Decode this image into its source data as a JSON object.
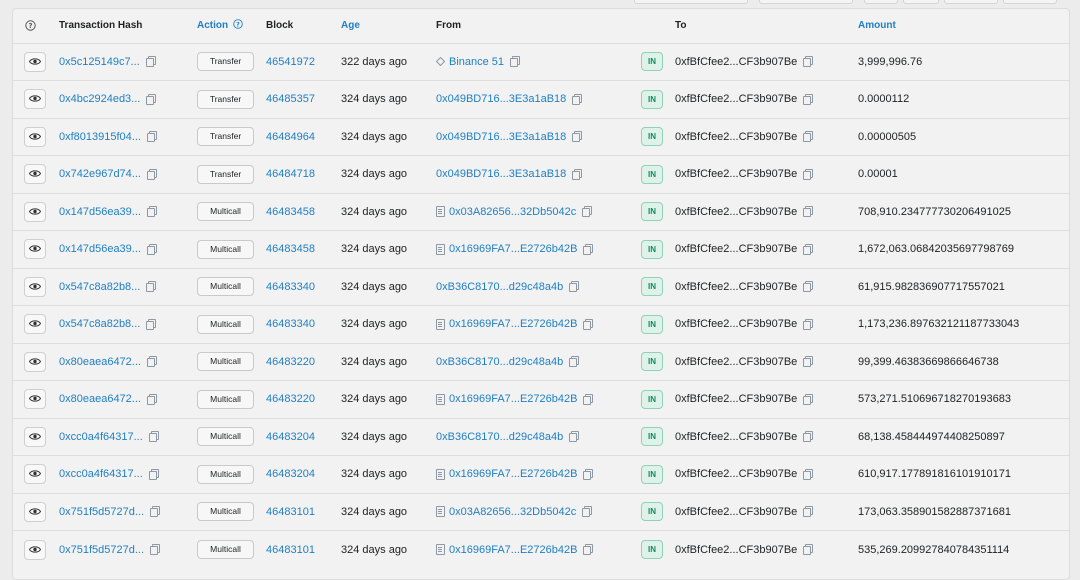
{
  "header": {
    "info_icon": "question-circle-icon",
    "transaction_hash": "Transaction Hash",
    "action": "Action",
    "action_icon": "question-circle-icon",
    "block": "Block",
    "age": "Age",
    "from": "From",
    "to": "To",
    "amount": "Amount"
  },
  "rows": [
    {
      "hash": "0x5c125149c7...",
      "action": "Transfer",
      "block": "46541972",
      "age": "322 days ago",
      "from": "Binance 51",
      "from_icon": "diamond-icon",
      "direction": "IN",
      "to": "0xfBfCfee2...CF3b907Be",
      "amount": "3,999,996.76"
    },
    {
      "hash": "0x4bc2924ed3...",
      "action": "Transfer",
      "block": "46485357",
      "age": "324 days ago",
      "from": "0x049BD716...3E3a1aB18",
      "from_icon": "",
      "direction": "IN",
      "to": "0xfBfCfee2...CF3b907Be",
      "amount": "0.0000112"
    },
    {
      "hash": "0xf8013915f04...",
      "action": "Transfer",
      "block": "46484964",
      "age": "324 days ago",
      "from": "0x049BD716...3E3a1aB18",
      "from_icon": "",
      "direction": "IN",
      "to": "0xfBfCfee2...CF3b907Be",
      "amount": "0.00000505"
    },
    {
      "hash": "0x742e967d74...",
      "action": "Transfer",
      "block": "46484718",
      "age": "324 days ago",
      "from": "0x049BD716...3E3a1aB18",
      "from_icon": "",
      "direction": "IN",
      "to": "0xfBfCfee2...CF3b907Be",
      "amount": "0.00001"
    },
    {
      "hash": "0x147d56ea39...",
      "action": "Multicall",
      "block": "46483458",
      "age": "324 days ago",
      "from": "0x03A82656...32Db5042c",
      "from_icon": "contract-icon",
      "direction": "IN",
      "to": "0xfBfCfee2...CF3b907Be",
      "amount": "708,910.234777730206491025"
    },
    {
      "hash": "0x147d56ea39...",
      "action": "Multicall",
      "block": "46483458",
      "age": "324 days ago",
      "from": "0x16969FA7...E2726b42B",
      "from_icon": "contract-icon",
      "direction": "IN",
      "to": "0xfBfCfee2...CF3b907Be",
      "amount": "1,672,063.06842035697798769"
    },
    {
      "hash": "0x547c8a82b8...",
      "action": "Multicall",
      "block": "46483340",
      "age": "324 days ago",
      "from": "0xB36C8170...d29c48a4b",
      "from_icon": "",
      "direction": "IN",
      "to": "0xfBfCfee2...CF3b907Be",
      "amount": "61,915.982836907717557021"
    },
    {
      "hash": "0x547c8a82b8...",
      "action": "Multicall",
      "block": "46483340",
      "age": "324 days ago",
      "from": "0x16969FA7...E2726b42B",
      "from_icon": "contract-icon",
      "direction": "IN",
      "to": "0xfBfCfee2...CF3b907Be",
      "amount": "1,173,236.897632121187733043"
    },
    {
      "hash": "0x80eaea6472...",
      "action": "Multicall",
      "block": "46483220",
      "age": "324 days ago",
      "from": "0xB36C8170...d29c48a4b",
      "from_icon": "",
      "direction": "IN",
      "to": "0xfBfCfee2...CF3b907Be",
      "amount": "99,399.46383669866646738"
    },
    {
      "hash": "0x80eaea6472...",
      "action": "Multicall",
      "block": "46483220",
      "age": "324 days ago",
      "from": "0x16969FA7...E2726b42B",
      "from_icon": "contract-icon",
      "direction": "IN",
      "to": "0xfBfCfee2...CF3b907Be",
      "amount": "573,271.510696718270193683"
    },
    {
      "hash": "0xcc0a4f64317...",
      "action": "Multicall",
      "block": "46483204",
      "age": "324 days ago",
      "from": "0xB36C8170...d29c48a4b",
      "from_icon": "",
      "direction": "IN",
      "to": "0xfBfCfee2...CF3b907Be",
      "amount": "68,138.458444974408250897"
    },
    {
      "hash": "0xcc0a4f64317...",
      "action": "Multicall",
      "block": "46483204",
      "age": "324 days ago",
      "from": "0x16969FA7...E2726b42B",
      "from_icon": "contract-icon",
      "direction": "IN",
      "to": "0xfBfCfee2...CF3b907Be",
      "amount": "610,917.177891816101910171"
    },
    {
      "hash": "0x751f5d5727d...",
      "action": "Multicall",
      "block": "46483101",
      "age": "324 days ago",
      "from": "0x03A82656...32Db5042c",
      "from_icon": "contract-icon",
      "direction": "IN",
      "to": "0xfBfCfee2...CF3b907Be",
      "amount": "173,063.358901582887371681"
    },
    {
      "hash": "0x751f5d5727d...",
      "action": "Multicall",
      "block": "46483101",
      "age": "324 days ago",
      "from": "0x16969FA7...E2726b42B",
      "from_icon": "contract-icon",
      "direction": "IN",
      "to": "0xfBfCfee2...CF3b907Be",
      "amount": "535,269.209927840784351114"
    }
  ],
  "row_icons": {
    "view": "eye-icon",
    "copy": "copy-icon"
  }
}
